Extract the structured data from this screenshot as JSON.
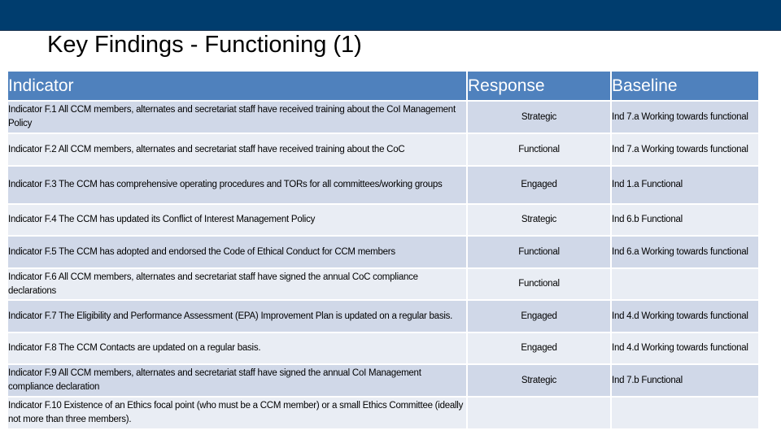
{
  "slide": {
    "title": "Key Findings - Functioning (1)"
  },
  "colors": {
    "top_bar": "#003D6E",
    "header": "#4F81BD",
    "row_dark": "#D0D8E8",
    "row_light": "#E9EDF4"
  },
  "table": {
    "headers": {
      "indicator": "Indicator",
      "response": "Response",
      "baseline": "Baseline"
    },
    "rows": [
      {
        "indicator": "Indicator F.1 All CCM members, alternates and secretariat staff have received training about the CoI Management Policy",
        "response": "Strategic",
        "baseline": "Ind 7.a Working towards functional"
      },
      {
        "indicator": "Indicator F.2 All CCM members, alternates and secretariat staff have received training about the CoC",
        "response": "Functional",
        "baseline": "Ind 7.a Working towards functional"
      },
      {
        "indicator": "Indicator F.3 The CCM has comprehensive operating procedures and TORs for all committees/working groups",
        "response": "Engaged",
        "baseline": "Ind 1.a Functional"
      },
      {
        "indicator": "Indicator F.4 The CCM has updated its Conflict of Interest Management Policy",
        "response": "Strategic",
        "baseline": "Ind 6.b Functional"
      },
      {
        "indicator": "Indicator F.5 The CCM has adopted and endorsed the Code of Ethical Conduct for CCM members",
        "response": "Functional",
        "baseline": "Ind 6.a Working towards functional"
      },
      {
        "indicator": "Indicator F.6 All CCM members, alternates and secretariat staff have signed the annual CoC compliance declarations",
        "response": "Functional",
        "baseline": ""
      },
      {
        "indicator": "Indicator F.7 The Eligibility and Performance Assessment (EPA) Improvement Plan is updated on a regular basis.",
        "response": "Engaged",
        "baseline": "Ind 4.d Working towards functional"
      },
      {
        "indicator": "Indicator F.8  The CCM Contacts are updated on a regular basis.",
        "response": "Engaged",
        "baseline": "Ind 4.d Working towards functional"
      },
      {
        "indicator": "Indicator F.9 All CCM members, alternates and secretariat staff have signed the annual CoI Management compliance declaration",
        "response": "Strategic",
        "baseline": "Ind 7.b Functional"
      },
      {
        "indicator": "Indicator F.10  Existence of an Ethics focal point (who must be a CCM member) or a small Ethics Committee (ideally not more than three members).",
        "response": "",
        "baseline": ""
      }
    ]
  }
}
